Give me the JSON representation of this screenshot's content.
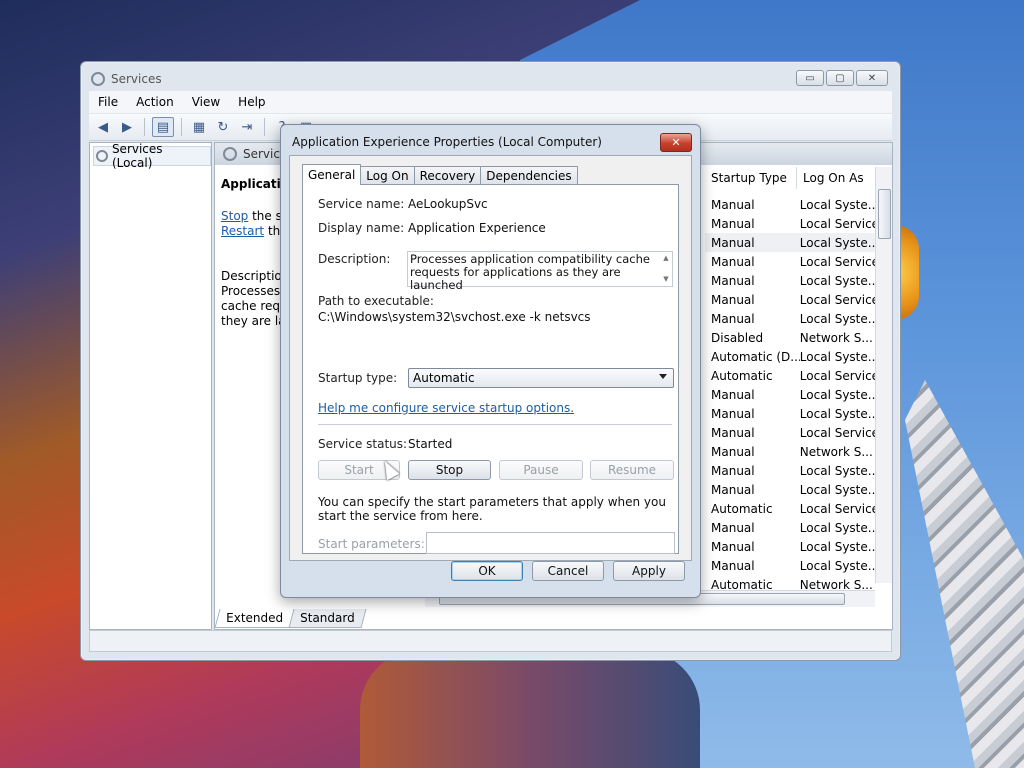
{
  "window": {
    "title": "Services",
    "menu": [
      "File",
      "Action",
      "View",
      "Help"
    ],
    "minimize_glyph": "▭",
    "maximize_glyph": "▢",
    "close_glyph": "✕"
  },
  "tree": {
    "root_label": "Services (Local)"
  },
  "main": {
    "header_label": "Servic",
    "extended": {
      "service_title": "Applicatio",
      "stop_link": "Stop",
      "stop_suffix": " the ser",
      "restart_link": "Restart",
      "restart_suffix": " the",
      "description_label": "Description",
      "description_lines": [
        "Processes a",
        "cache reque",
        "they are lau"
      ]
    },
    "columns": {
      "startup_type": "Startup Type",
      "log_on_as": "Log On As"
    },
    "rows": [
      [
        "Manual",
        "Local Syste..."
      ],
      [
        "Manual",
        "Local Service"
      ],
      [
        "Manual",
        "Local Syste..."
      ],
      [
        "Manual",
        "Local Service"
      ],
      [
        "Manual",
        "Local Syste..."
      ],
      [
        "Manual",
        "Local Service"
      ],
      [
        "Manual",
        "Local Syste..."
      ],
      [
        "Disabled",
        "Network S..."
      ],
      [
        "Automatic (D...",
        "Local Syste..."
      ],
      [
        "Automatic",
        "Local Service"
      ],
      [
        "Manual",
        "Local Syste..."
      ],
      [
        "Manual",
        "Local Syste..."
      ],
      [
        "Manual",
        "Local Service"
      ],
      [
        "Manual",
        "Network S..."
      ],
      [
        "Manual",
        "Local Syste..."
      ],
      [
        "Manual",
        "Local Syste..."
      ],
      [
        "Automatic",
        "Local Service"
      ],
      [
        "Manual",
        "Local Syste..."
      ],
      [
        "Manual",
        "Local Syste..."
      ],
      [
        "Manual",
        "Local Syste..."
      ],
      [
        "Automatic",
        "Network S..."
      ]
    ],
    "selected_row_index": 2,
    "bottom_tabs": [
      "Extended",
      "Standard"
    ]
  },
  "dialog": {
    "title": "Application Experience Properties (Local Computer)",
    "close_glyph": "✕",
    "tabs": [
      "General",
      "Log On",
      "Recovery",
      "Dependencies"
    ],
    "active_tab": "General",
    "service_name_label": "Service name:",
    "service_name": "AeLookupSvc",
    "display_name_label": "Display name:",
    "display_name": "Application Experience",
    "description_label": "Description:",
    "description": "Processes application compatibility cache requests for applications as they are launched",
    "path_label": "Path to executable:",
    "path": "C:\\Windows\\system32\\svchost.exe -k netsvcs",
    "startup_type_label": "Startup type:",
    "startup_type": "Automatic",
    "help_link": "Help me configure service startup options.",
    "status_label": "Service status:",
    "status": "Started",
    "buttons": {
      "start": "Start",
      "stop": "Stop",
      "pause": "Pause",
      "resume": "Resume"
    },
    "note": "You can specify the start parameters that apply when you start the service from here.",
    "params_label": "Start parameters:",
    "params_value": "",
    "ok": "OK",
    "cancel": "Cancel",
    "apply": "Apply"
  },
  "colors": {
    "link": "#1a5ea8",
    "close_button": "#c8402c",
    "default_button_border": "#3c7fb1"
  }
}
